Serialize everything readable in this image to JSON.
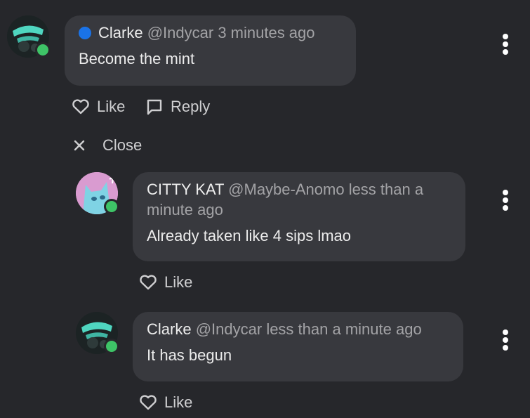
{
  "comments": [
    {
      "author": "Clarke",
      "handle": "@Indycar",
      "time": "3 minutes ago",
      "text": "Become the mint",
      "like_label": "Like",
      "reply_label": "Reply",
      "close_label": "Close"
    },
    {
      "author": "CITTY KAT",
      "handle": "@Maybe-Anomo",
      "time_line1": "less than a",
      "time_line2": "minute ago",
      "text": "Already taken like 4 sips lmao",
      "like_label": "Like"
    },
    {
      "author": "Clarke",
      "handle": "@Indycar",
      "time": "less than a minute ago",
      "text": "It has begun",
      "like_label": "Like"
    }
  ],
  "colors": {
    "background": "#26272b",
    "bubble": "#38393e",
    "online": "#3ec467",
    "badge": "#1a73e8"
  },
  "icons": [
    "heart-icon",
    "reply-icon",
    "close-icon",
    "more-vert-icon",
    "verified-dot-icon"
  ]
}
